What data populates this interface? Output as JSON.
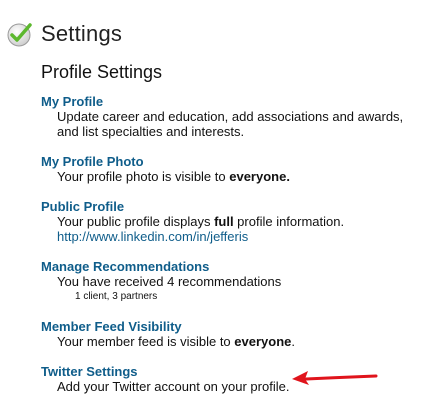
{
  "header": {
    "title": "Settings",
    "icon": "check-circle-icon"
  },
  "section": {
    "title": "Profile Settings"
  },
  "items": [
    {
      "title": "My Profile",
      "desc_line1": "Update career and education, add associations and awards,",
      "desc_line2": "and list specialties and interests."
    },
    {
      "title": "My Profile Photo",
      "desc_pre": "Your profile photo is visible to ",
      "desc_bold": "everyone."
    },
    {
      "title": "Public Profile",
      "desc_pre": "Your public profile displays ",
      "desc_bold": "full",
      "desc_post": " profile information.",
      "link": "http://www.linkedin.com/in/jefferis"
    },
    {
      "title": "Manage Recommendations",
      "desc": "You have received 4 recommendations",
      "detail": "1 client, 3 partners"
    },
    {
      "title": "Member Feed Visibility",
      "desc_pre": "Your member feed is visible to ",
      "desc_bold": "everyone",
      "desc_post": "."
    },
    {
      "title": "Twitter Settings",
      "desc": "Add your Twitter account on your profile."
    }
  ],
  "annotation": {
    "arrow_color": "#e0141c",
    "icon": "red-arrow-icon"
  },
  "colors": {
    "link": "#0f5d8a",
    "check": "#5cb82e"
  }
}
